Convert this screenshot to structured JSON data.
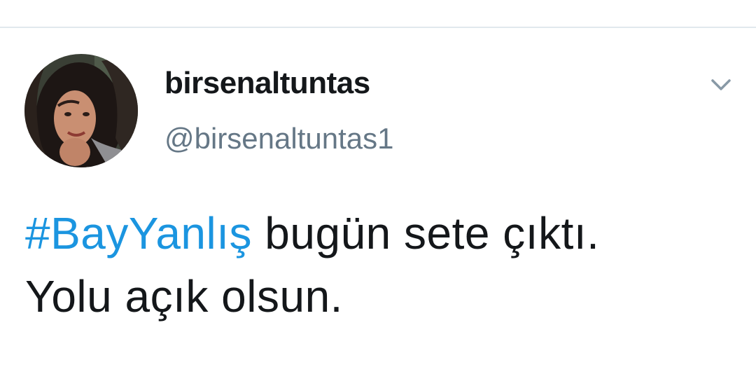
{
  "user": {
    "display_name": "birsenaltuntas",
    "handle": "@birsenaltuntas1"
  },
  "header": {
    "caret_icon": "chevron-down-icon"
  },
  "tweet": {
    "hashtag": "#BayYanlış",
    "line1_rest": " bugün sete çıktı.",
    "line2": "Yolu açık olsun."
  },
  "colors": {
    "hashtag": "#1b95e0",
    "text": "#14171a",
    "handle": "#657786",
    "divider": "#e1e8ed"
  }
}
